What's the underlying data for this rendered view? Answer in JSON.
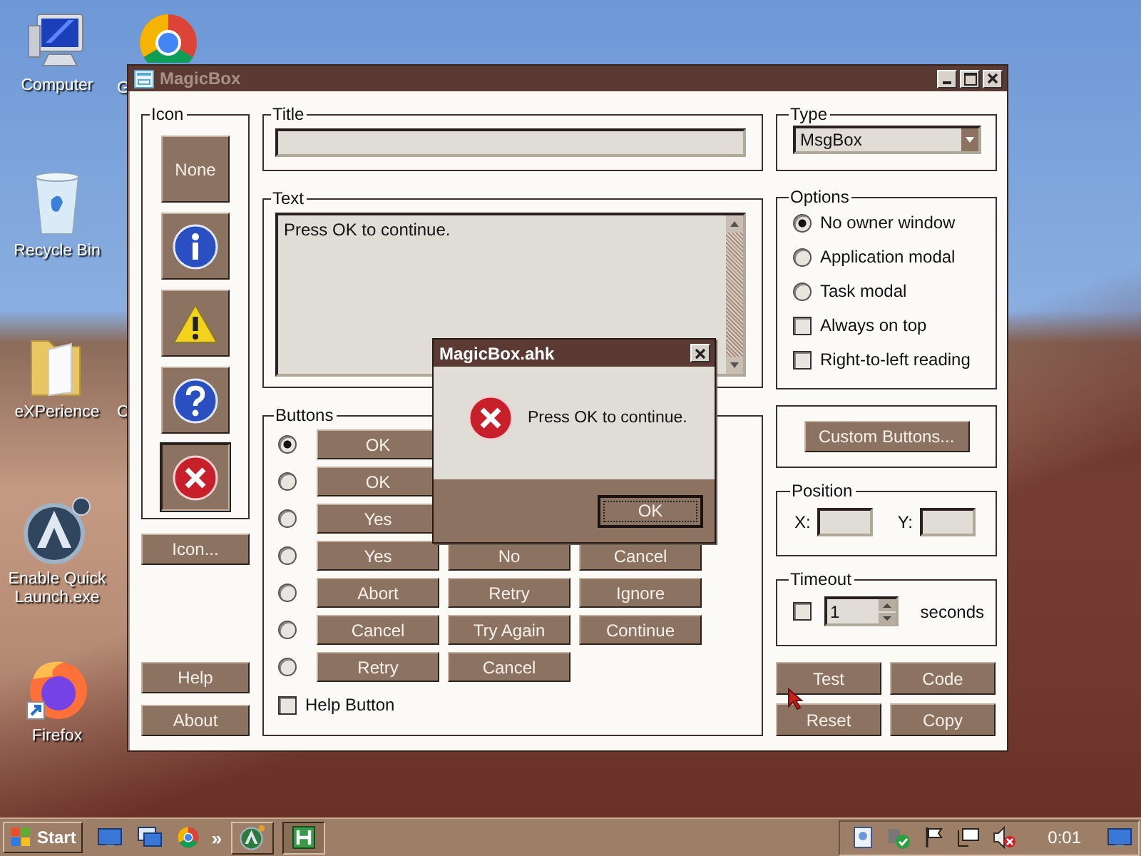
{
  "desktop_icons": [
    {
      "kind": "computer",
      "label": "Computer"
    },
    {
      "kind": "chrome",
      "label": "G"
    },
    {
      "kind": "recycle",
      "label": "Recycle Bin"
    },
    {
      "kind": "folder",
      "label": "eXPerience"
    },
    {
      "kind": "hidden",
      "label": "C"
    },
    {
      "kind": "autoit",
      "label": "Enable Quick Launch.exe"
    },
    {
      "kind": "firefox",
      "label": "Firefox"
    }
  ],
  "window": {
    "title": "MagicBox",
    "icon_group": {
      "label": "Icon",
      "options": [
        {
          "kind": "none",
          "label": "None",
          "selected": false
        },
        {
          "kind": "info",
          "selected": false
        },
        {
          "kind": "warning",
          "selected": false
        },
        {
          "kind": "question",
          "selected": false
        },
        {
          "kind": "error",
          "selected": true
        }
      ],
      "browse_button": "Icon..."
    },
    "help_button": "Help",
    "about_button": "About",
    "title_group": {
      "label": "Title"
    },
    "text_group": {
      "label": "Text",
      "value": "Press OK to continue."
    },
    "buttons_group": {
      "label": "Buttons",
      "rows": [
        {
          "selected": true,
          "buttons": [
            "OK"
          ]
        },
        {
          "selected": false,
          "buttons": [
            "OK"
          ]
        },
        {
          "selected": false,
          "buttons": [
            "Yes"
          ]
        },
        {
          "selected": false,
          "buttons": [
            "Yes",
            "No",
            "Cancel"
          ]
        },
        {
          "selected": false,
          "buttons": [
            "Abort",
            "Retry",
            "Ignore"
          ]
        },
        {
          "selected": false,
          "buttons": [
            "Cancel",
            "Try Again",
            "Continue"
          ]
        },
        {
          "selected": false,
          "buttons": [
            "Retry",
            "Cancel"
          ]
        }
      ],
      "help_checkbox": {
        "label": "Help Button",
        "checked": false
      }
    },
    "type_group": {
      "label": "Type",
      "value": "MsgBox"
    },
    "options_group": {
      "label": "Options",
      "items": [
        {
          "kind": "radio",
          "label": "No owner window",
          "checked": true
        },
        {
          "kind": "radio",
          "label": "Application modal",
          "checked": false
        },
        {
          "kind": "radio",
          "label": "Task modal",
          "checked": false
        },
        {
          "kind": "checkbox",
          "label": "Always on top",
          "checked": false
        },
        {
          "kind": "checkbox",
          "label": "Right-to-left reading",
          "checked": false
        }
      ]
    },
    "custom_buttons": "Custom Buttons...",
    "position_group": {
      "label": "Position",
      "x_label": "X:",
      "y_label": "Y:"
    },
    "timeout_group": {
      "label": "Timeout",
      "checked": false,
      "value": "1",
      "unit": "seconds"
    },
    "actions": [
      "Test",
      "Code",
      "Reset",
      "Copy"
    ]
  },
  "popup": {
    "title": "MagicBox.ahk",
    "kind": "error",
    "message": "Press OK to continue.",
    "button": "OK"
  },
  "taskbar": {
    "start": "Start",
    "chevron": "»",
    "clock": "0:01"
  }
}
